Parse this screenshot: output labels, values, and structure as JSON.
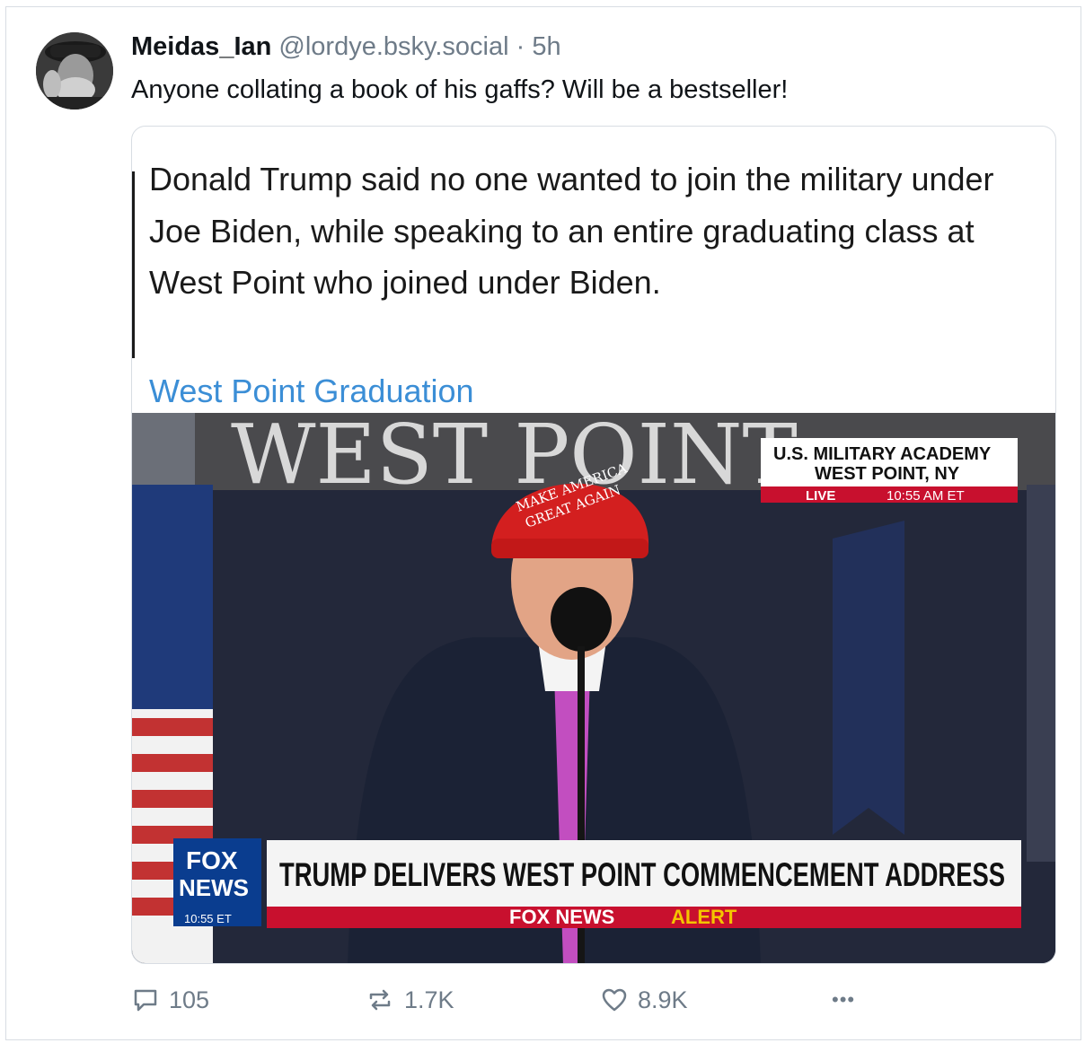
{
  "post": {
    "author_name": "Meidas_Ian",
    "author_handle": "@lordye.bsky.social",
    "separator": "·",
    "time": "5h",
    "text": "Anyone collating a book of his gaffs? Will be a bestseller!"
  },
  "embed": {
    "text": "Donald Trump said no one wanted to join the military under Joe Biden, while speaking to an entire graduating class at West Point who joined under Biden.",
    "link_text": "West Point Graduation",
    "link_color": "#3b8ed6",
    "media": {
      "wall_text": "WEST POINT",
      "hat_line1": "MAKE AMERICA",
      "hat_line2": "GREAT AGAIN",
      "location_line1": "U.S. MILITARY ACADEMY",
      "location_line2": "WEST POINT, NY",
      "live_label": "LIVE",
      "live_time": "10:55 AM ET",
      "network_line1": "FOX",
      "network_line2": "NEWS",
      "network_time": "10:55 ET",
      "headline": "TRUMP DELIVERS WEST POINT COMMENCEMENT ADDRESS",
      "alert_prefix": "FOX NEWS",
      "alert_word": "ALERT",
      "fox_red": "#c8102e",
      "fox_blue": "#0a3d8f",
      "alert_yellow": "#f4c400"
    }
  },
  "actions": {
    "replies": "105",
    "reposts": "1.7K",
    "likes": "8.9K",
    "more": "•••"
  },
  "icons": {
    "reply": "reply-icon",
    "repost": "repost-icon",
    "like": "heart-icon",
    "more": "more-icon"
  },
  "colors": {
    "muted": "#6e7b88",
    "text": "#101418",
    "border": "#d8dde3"
  }
}
